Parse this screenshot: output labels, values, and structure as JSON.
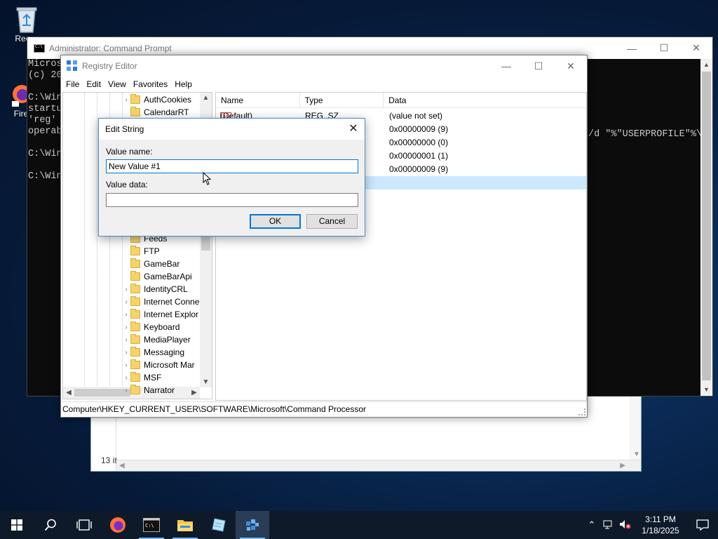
{
  "desktop": {
    "recycle_label": "Recyc",
    "firefox_label": "Fire"
  },
  "explorer_back": {
    "item_count": "13 it"
  },
  "cmd": {
    "title": "Administrator: Command Prompt",
    "lines": [
      "Micros",
      "(c) 20",
      "",
      "C:\\Win",
      "startu",
      "'reg'",
      "operab",
      "",
      "C:\\Win",
      "",
      "C:\\Win"
    ],
    "right_text": "/d \"%\"USERPROFILE\"%\\"
  },
  "regedit": {
    "title": "Registry Editor",
    "menu": [
      "File",
      "Edit",
      "View",
      "Favorites",
      "Help"
    ],
    "tree_top": [
      {
        "label": "AuthCookies",
        "expandable": true
      },
      {
        "label": "CalendarRT",
        "expandable": false
      }
    ],
    "tree_bottom": [
      {
        "label": "Feeds",
        "expandable": false
      },
      {
        "label": "FTP",
        "expandable": false
      },
      {
        "label": "GameBar",
        "expandable": false
      },
      {
        "label": "GameBarApi",
        "expandable": false
      },
      {
        "label": "IdentityCRL",
        "expandable": true
      },
      {
        "label": "Internet Conne",
        "expandable": true
      },
      {
        "label": "Internet Explor",
        "expandable": true
      },
      {
        "label": "Keyboard",
        "expandable": true
      },
      {
        "label": "MediaPlayer",
        "expandable": true
      },
      {
        "label": "Messaging",
        "expandable": true
      },
      {
        "label": "Microsoft Mar",
        "expandable": true
      },
      {
        "label": "MSF",
        "expandable": true
      },
      {
        "label": "Narrator",
        "expandable": true
      }
    ],
    "columns": [
      "Name",
      "Type",
      "Data"
    ],
    "rows": [
      {
        "name": "(Default)",
        "type": "REG_SZ",
        "data": "(value not set)"
      },
      {
        "name": "",
        "type": "",
        "data": "0x00000009 (9)"
      },
      {
        "name": "",
        "type": "",
        "data": "0x00000000 (0)"
      },
      {
        "name": "",
        "type": "",
        "data": "0x00000001 (1)"
      },
      {
        "name": "",
        "type": "",
        "data": "0x00000009 (9)"
      },
      {
        "name": "",
        "type": "",
        "data": ""
      }
    ],
    "status_path": "Computer\\HKEY_CURRENT_USER\\SOFTWARE\\Microsoft\\Command Processor"
  },
  "dialog": {
    "title": "Edit String",
    "value_name_label": "Value name:",
    "value_name": "New Value #1",
    "value_data_label": "Value data:",
    "value_data": "",
    "ok_label": "OK",
    "cancel_label": "Cancel"
  },
  "taskbar": {
    "time": "3:11 PM",
    "date": "1/18/2025"
  },
  "colors": {
    "accent": "#0078d7",
    "selection": "#cce8ff",
    "taskbar": "#0e1a2a"
  }
}
